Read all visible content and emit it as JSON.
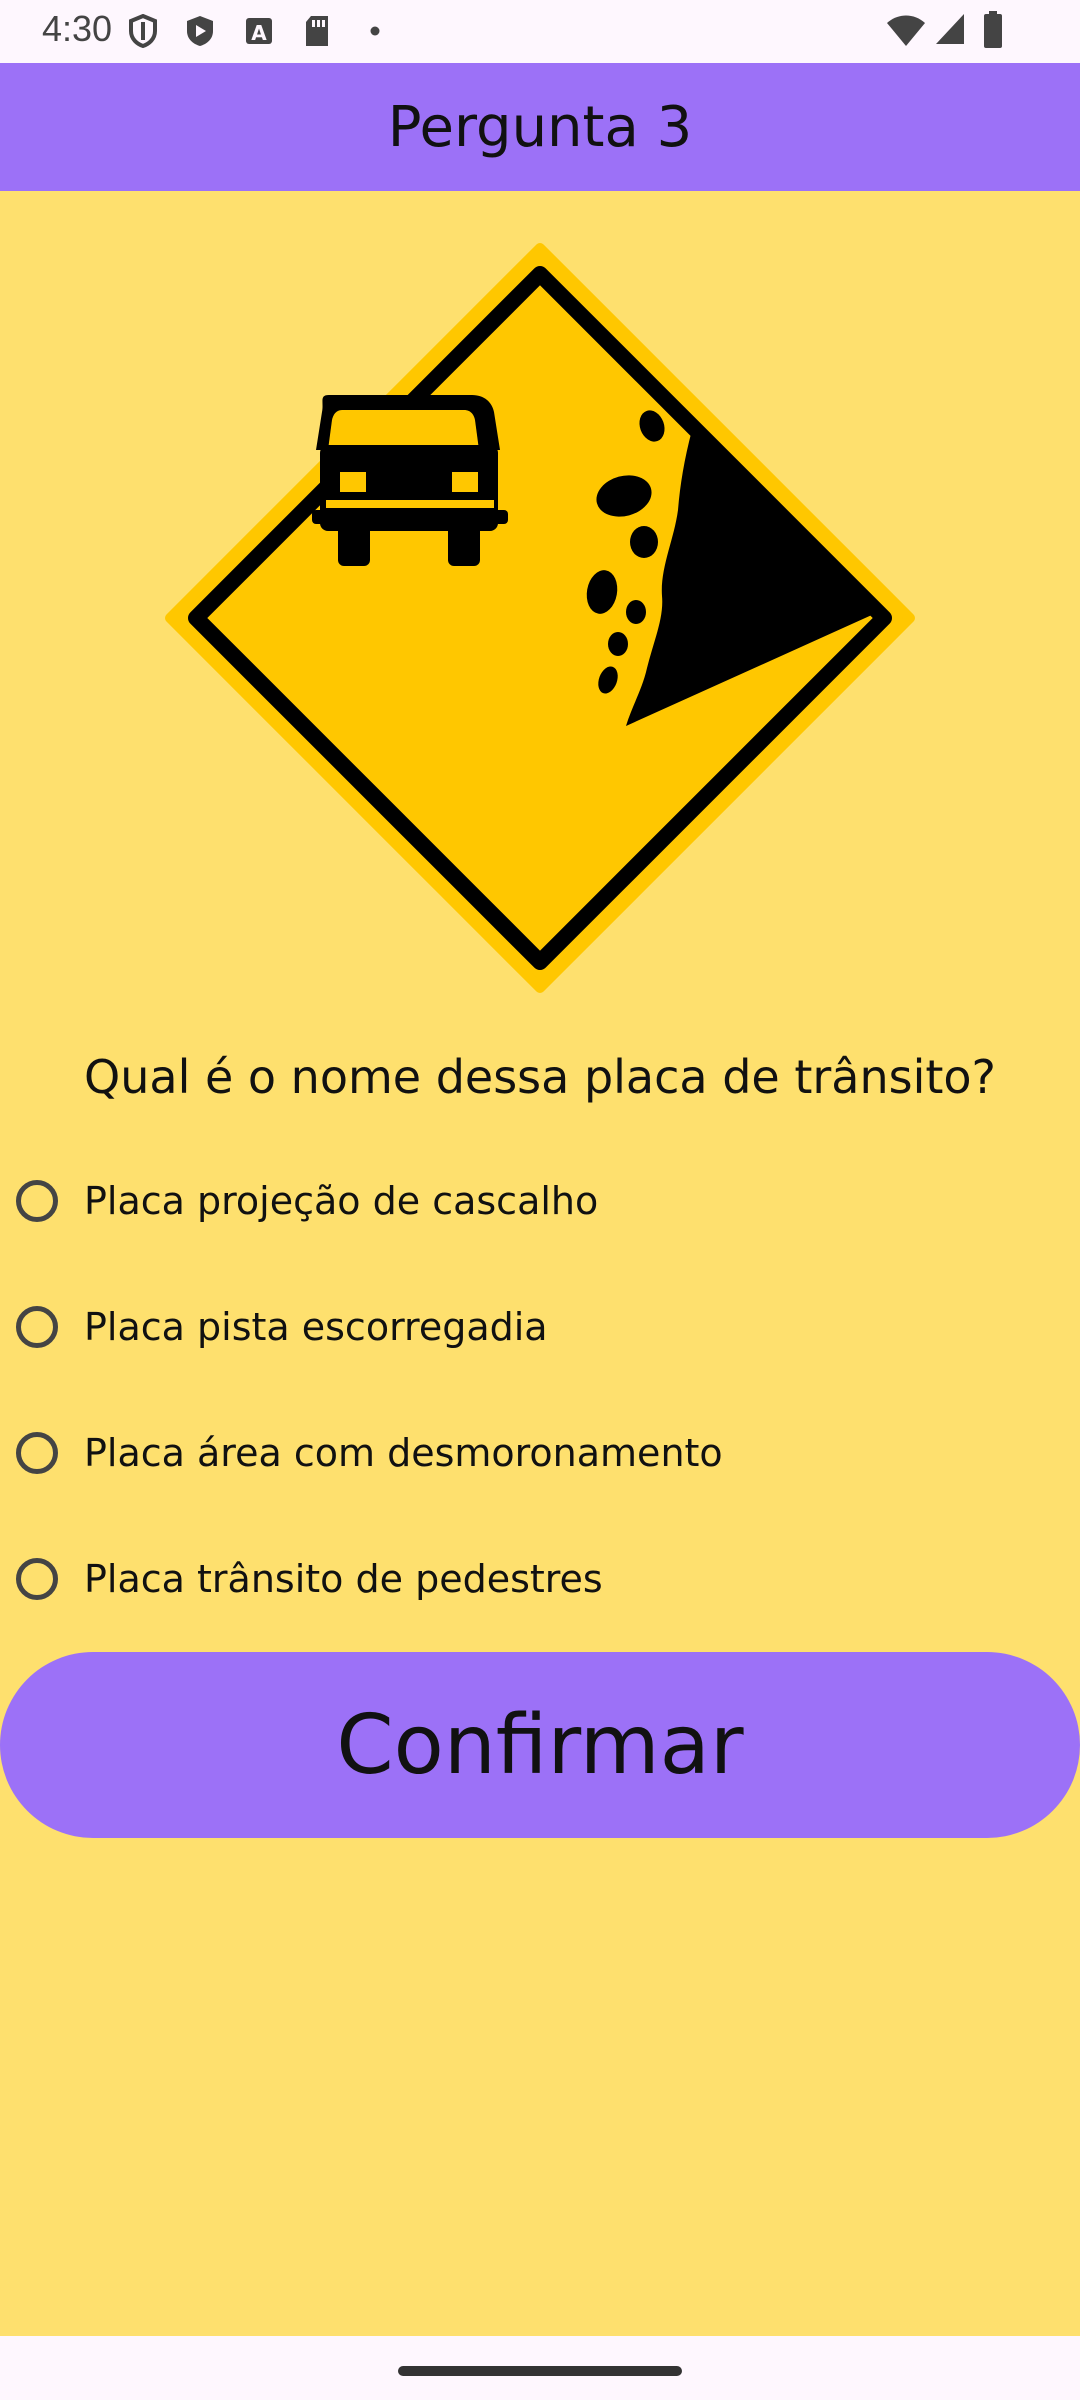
{
  "status_bar": {
    "time": "4:30"
  },
  "app_bar": {
    "title": "Pergunta 3"
  },
  "question": "Qual é o nome dessa placa de trânsito?",
  "options": [
    {
      "label": "Placa projeção de cascalho"
    },
    {
      "label": "Placa pista escorregadia"
    },
    {
      "label": "Placa área com desmoronamento"
    },
    {
      "label": "Placa trânsito de pedestres"
    }
  ],
  "confirm_label": "Confirmar",
  "colors": {
    "background": "#FEE06E",
    "accent": "#9C71F7",
    "sign_yellow": "#FFC700",
    "sign_black": "#000000"
  }
}
